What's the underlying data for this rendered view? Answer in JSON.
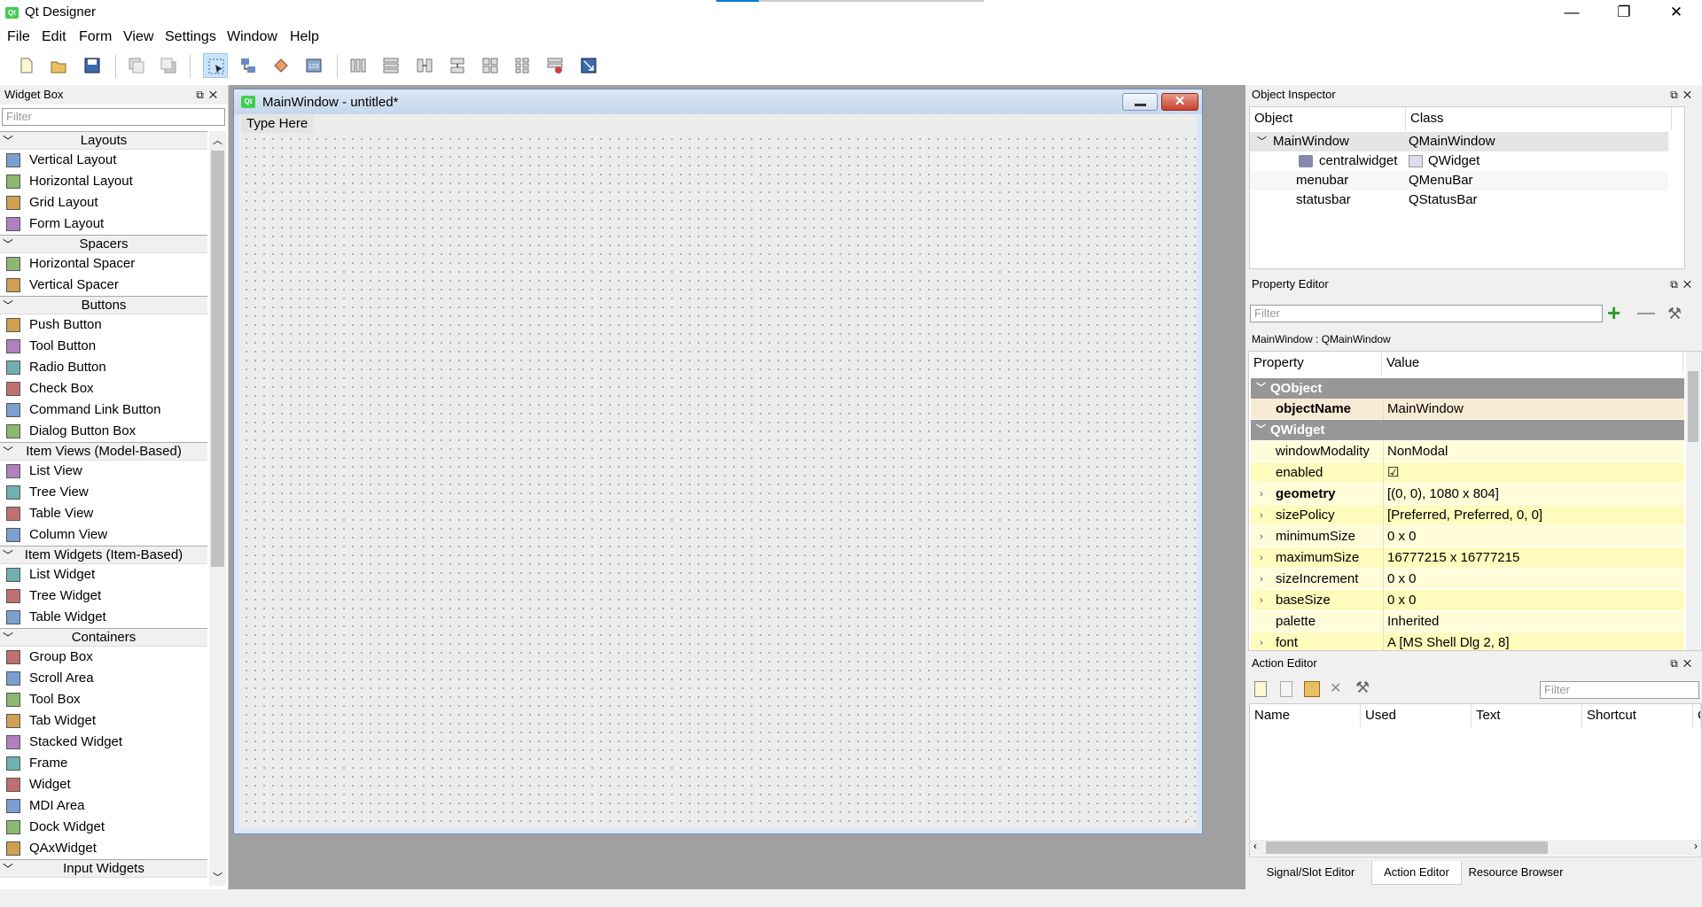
{
  "app": {
    "title": "Qt Designer",
    "qt_logo": "Qt",
    "progress_fraction": 0.16,
    "accent": "#41cd52"
  },
  "window_controls": {
    "minimize": "—",
    "maximize": "❐",
    "close": "✕"
  },
  "menu": [
    "File",
    "Edit",
    "Form",
    "View",
    "Settings",
    "Window",
    "Help"
  ],
  "toolbar": [
    "new-form-icon",
    "open-form-icon",
    "save-form-icon",
    "send-to-back-icon",
    "bring-to-front-icon",
    "edit-widgets-icon",
    "edit-signals-slots-icon",
    "edit-buddies-icon",
    "edit-tab-order-icon",
    "layout-horizontal-icon",
    "layout-vertical-icon",
    "layout-horizontal-splitter-icon",
    "layout-vertical-splitter-icon",
    "layout-grid-icon",
    "layout-form-icon",
    "break-layout-icon",
    "adjust-size-icon"
  ],
  "widget_box": {
    "title": "Widget Box",
    "filter_placeholder": "Filter",
    "categories": [
      {
        "name": "Layouts",
        "items": [
          "Vertical Layout",
          "Horizontal Layout",
          "Grid Layout",
          "Form Layout"
        ]
      },
      {
        "name": "Spacers",
        "items": [
          "Horizontal Spacer",
          "Vertical Spacer"
        ]
      },
      {
        "name": "Buttons",
        "items": [
          "Push Button",
          "Tool Button",
          "Radio Button",
          "Check Box",
          "Command Link Button",
          "Dialog Button Box"
        ]
      },
      {
        "name": "Item Views (Model-Based)",
        "items": [
          "List View",
          "Tree View",
          "Table View",
          "Column View"
        ]
      },
      {
        "name": "Item Widgets (Item-Based)",
        "items": [
          "List Widget",
          "Tree Widget",
          "Table Widget"
        ]
      },
      {
        "name": "Containers",
        "items": [
          "Group Box",
          "Scroll Area",
          "Tool Box",
          "Tab Widget",
          "Stacked Widget",
          "Frame",
          "Widget",
          "MDI Area",
          "Dock Widget",
          "QAxWidget"
        ]
      },
      {
        "name": "Input Widgets",
        "items": []
      }
    ]
  },
  "form": {
    "title": "MainWindow - untitled*",
    "menu_placeholder": "Type Here"
  },
  "object_inspector": {
    "title": "Object Inspector",
    "columns": [
      "Object",
      "Class"
    ],
    "rows": [
      {
        "object": "MainWindow",
        "class": "QMainWindow"
      },
      {
        "object": "centralwidget",
        "class": "QWidget"
      },
      {
        "object": "menubar",
        "class": "QMenuBar"
      },
      {
        "object": "statusbar",
        "class": "QStatusBar"
      }
    ]
  },
  "property_editor": {
    "title": "Property Editor",
    "filter_placeholder": "Filter",
    "context": "MainWindow : QMainWindow",
    "columns": [
      "Property",
      "Value"
    ],
    "groups": [
      "QObject",
      "QWidget"
    ],
    "props": [
      {
        "name": "objectName",
        "value": "MainWindow"
      },
      {
        "name": "windowModality",
        "value": "NonModal"
      },
      {
        "name": "enabled",
        "value": "☑"
      },
      {
        "name": "geometry",
        "value": "[(0, 0), 1080 x 804]"
      },
      {
        "name": "sizePolicy",
        "value": "[Preferred, Preferred, 0, 0]"
      },
      {
        "name": "minimumSize",
        "value": "0 x 0"
      },
      {
        "name": "maximumSize",
        "value": "16777215 x 16777215"
      },
      {
        "name": "sizeIncrement",
        "value": "0 x 0"
      },
      {
        "name": "baseSize",
        "value": "0 x 0"
      },
      {
        "name": "palette",
        "value": "Inherited"
      },
      {
        "name": "font",
        "value": "A  [MS Shell Dlg 2, 8]"
      }
    ]
  },
  "action_editor": {
    "title": "Action Editor",
    "filter_placeholder": "Filter",
    "columns": [
      "Name",
      "Used",
      "Text",
      "Shortcut",
      "C"
    ]
  },
  "bottom_tabs": [
    "Signal/Slot Editor",
    "Action Editor",
    "Resource Browser"
  ]
}
